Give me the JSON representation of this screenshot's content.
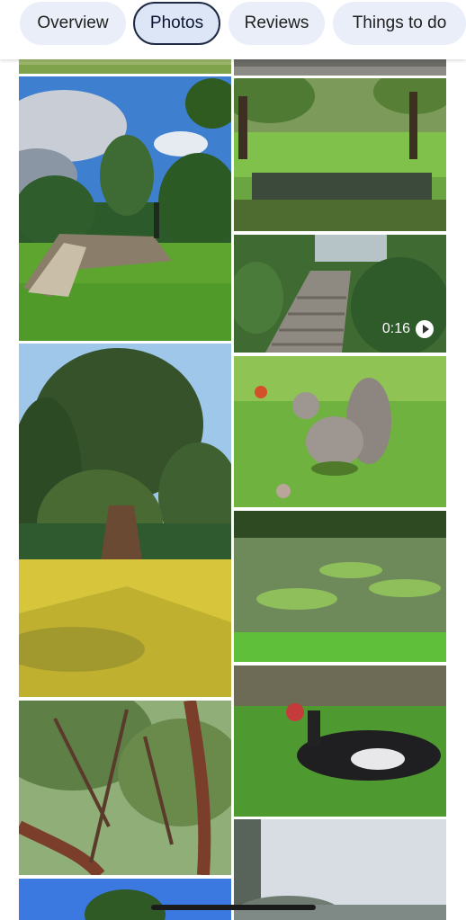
{
  "tabs": [
    {
      "label": "Overview",
      "active": false
    },
    {
      "label": "Photos",
      "active": true
    },
    {
      "label": "Reviews",
      "active": false
    },
    {
      "label": "Things to do",
      "active": false
    }
  ],
  "photos": [
    {
      "subject": "fallen tree trunk on lawn"
    },
    {
      "subject": "pond under tall trees"
    },
    {
      "subject": "stone steps path"
    },
    {
      "subject": "large tree on yellow lawn"
    },
    {
      "subject": "squirrel on grass"
    },
    {
      "subject": "pond with lily pads"
    },
    {
      "subject": "tree branches canopy"
    },
    {
      "subject": "muscovy duck on grass"
    },
    {
      "subject": "tree top against blue sky"
    },
    {
      "subject": "cloudy sky landscape"
    }
  ],
  "video": {
    "duration": "0:16"
  }
}
